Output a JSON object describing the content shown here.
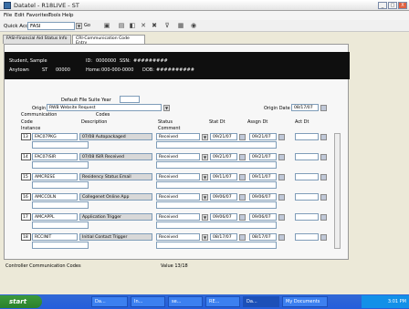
{
  "window": {
    "title": "Datatel - R18LIVE - ST",
    "minimize": "_",
    "maximize": "□",
    "close": "X"
  },
  "menu": [
    "File",
    "Edit",
    "Favorites",
    "Tools",
    "Help"
  ],
  "toolbar": {
    "quick_access_label": "Quick Access",
    "quick_access_value": "FASI",
    "go_label": "Go",
    "icons": [
      "save-icon",
      "print-icon",
      "print-preview-icon",
      "cancel-icon",
      "cancel-all-icon",
      "filter-icon",
      "table-icon",
      "help-icon"
    ]
  },
  "tabs": [
    {
      "label": "FASI-Financial Aid Status Info"
    },
    {
      "label": "CRI-Communication Code Entry"
    }
  ],
  "banner": {
    "line1_name": "Student, Sample",
    "line1_id_label": "ID:",
    "line1_id": "0000000",
    "line1_ssn_label": "SSN:",
    "line1_ssn": "#########",
    "line2_city": "Anytown",
    "line2_state": "ST",
    "line2_zip": "00000",
    "line2_home_label": "Home:",
    "line2_home": "000-000-0000",
    "line2_dob_label": "DOB:",
    "line2_dob": "##########"
  },
  "form": {
    "default_file_suite_label": "Default File Suite Year",
    "default_file_suite_value": "",
    "origin_label": "Origin",
    "origin_value": "RWB Website Request",
    "origin_date_label": "Origin Date",
    "origin_date_value": "08/17/07"
  },
  "headers": {
    "communication": "Communication",
    "code": "Code",
    "instance": "Instance",
    "codes": "Codes",
    "description": "Description",
    "status": "Status",
    "comment": "Comment",
    "stat_dt": "Stat Dt",
    "assgn_dt": "Assgn Dt",
    "act_dt": "Act Dt"
  },
  "rows": [
    {
      "num": "13",
      "code": "FAC07PKG",
      "desc": "07/08 Autopackaged",
      "status": "Received",
      "stat_dt": "09/21/07",
      "assgn_dt": "09/21/07",
      "act_dt": ""
    },
    {
      "num": "14",
      "code": "FAC07ISIR",
      "desc": "07/08 ISIR Received",
      "status": "Received",
      "stat_dt": "09/21/07",
      "assgn_dt": "09/21/07",
      "act_dt": ""
    },
    {
      "num": "15",
      "code": "AMCRESE",
      "desc": "Residency Status Email",
      "status": "Received",
      "stat_dt": "09/11/07",
      "assgn_dt": "09/11/07",
      "act_dt": ""
    },
    {
      "num": "16",
      "code": "AMCCOLN",
      "desc": "Collegenet Online App",
      "status": "Received",
      "stat_dt": "09/06/07",
      "assgn_dt": "09/06/07",
      "act_dt": ""
    },
    {
      "num": "17",
      "code": "AMCAPPL",
      "desc": "Application Trigger",
      "status": "Received",
      "stat_dt": "09/06/07",
      "assgn_dt": "09/06/07",
      "act_dt": ""
    },
    {
      "num": "18",
      "code": "RCCINIT",
      "desc": "Initial Contact Trigger",
      "status": "Received",
      "stat_dt": "08/17/07",
      "assgn_dt": "08/17/07",
      "act_dt": ""
    }
  ],
  "footer": {
    "left": "Controller Communication Codes",
    "value_label": "Value 13/18"
  },
  "taskbar": {
    "start": "start",
    "tasks": [
      "Da...",
      "In...",
      "se...",
      "RE...",
      "Da...",
      "My Documents"
    ],
    "clock": "3:01 PM"
  }
}
